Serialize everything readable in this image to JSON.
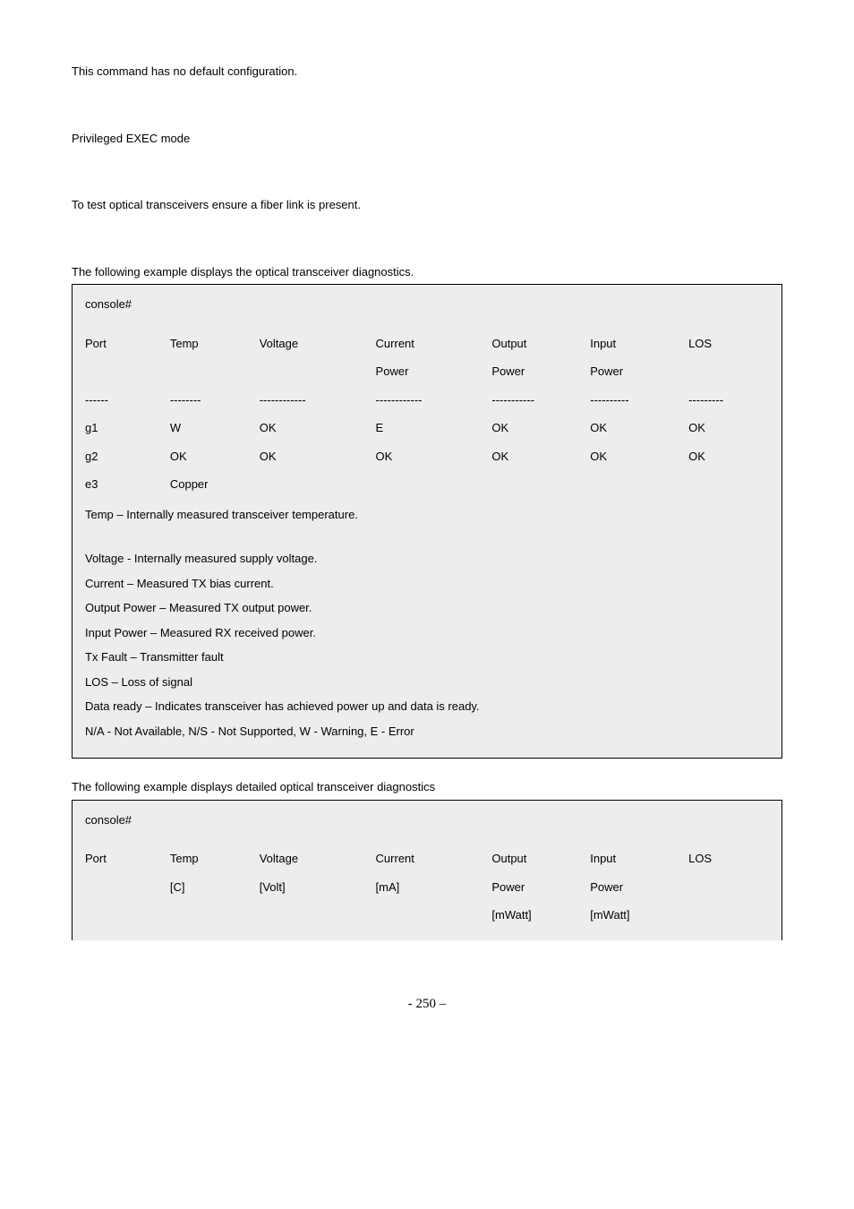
{
  "para": {
    "no_default": "This command has no default configuration.",
    "mode": "Privileged EXEC mode",
    "test_note": "To test optical transceivers ensure a fiber link is present.",
    "example1_intro": "The following example displays the optical transceiver diagnostics.",
    "example2_intro": "The following example displays detailed optical transceiver diagnostics"
  },
  "box1": {
    "prompt": "console#",
    "hdr": {
      "c1": "Port",
      "c2": "Temp",
      "c3": "Voltage",
      "c4": "Current",
      "c5": "Output",
      "c6": "Input",
      "c7": "LOS"
    },
    "hdr2": {
      "c4": "Power",
      "c5": "Power",
      "c6": "Power"
    },
    "dash": {
      "c1": "------",
      "c2": "--------",
      "c3": "------------",
      "c4": "------------",
      "c5": "-----------",
      "c6": "----------",
      "c7": "---------"
    },
    "r1": {
      "c1": "g1",
      "c2": "W",
      "c3": "OK",
      "c4": "E",
      "c5": "OK",
      "c6": "OK",
      "c7": "OK"
    },
    "r2": {
      "c1": "g2",
      "c2": "OK",
      "c3": "OK",
      "c4": "OK",
      "c5": "OK",
      "c6": "OK",
      "c7": "OK"
    },
    "r3": {
      "c1": "e3",
      "c2": "Copper"
    },
    "notes": {
      "n1": "Temp – Internally measured transceiver temperature.",
      "n2": "Voltage - Internally measured supply voltage.",
      "n3": "Current – Measured TX bias current.",
      "n4": "Output Power – Measured TX output power.",
      "n5": "Input Power – Measured RX received power.",
      "n6": "Tx Fault – Transmitter fault",
      "n7": "LOS – Loss of signal",
      "n8": "Data ready – Indicates transceiver has achieved power up and data is ready.",
      "n9": "N/A - Not Available, N/S - Not Supported, W - Warning, E - Error"
    }
  },
  "box2": {
    "prompt": "console#",
    "hdr": {
      "c1": "Port",
      "c2": "Temp",
      "c3": "Voltage",
      "c4": "Current",
      "c5": "Output",
      "c6": "Input",
      "c7": "LOS"
    },
    "hdr2": {
      "c2": "[C]",
      "c3": "[Volt]",
      "c4": "[mA]",
      "c5": "Power",
      "c6": "Power"
    },
    "hdr3": {
      "c5": "[mWatt]",
      "c6": "[mWatt]"
    }
  },
  "pagenum": "- 250 –"
}
